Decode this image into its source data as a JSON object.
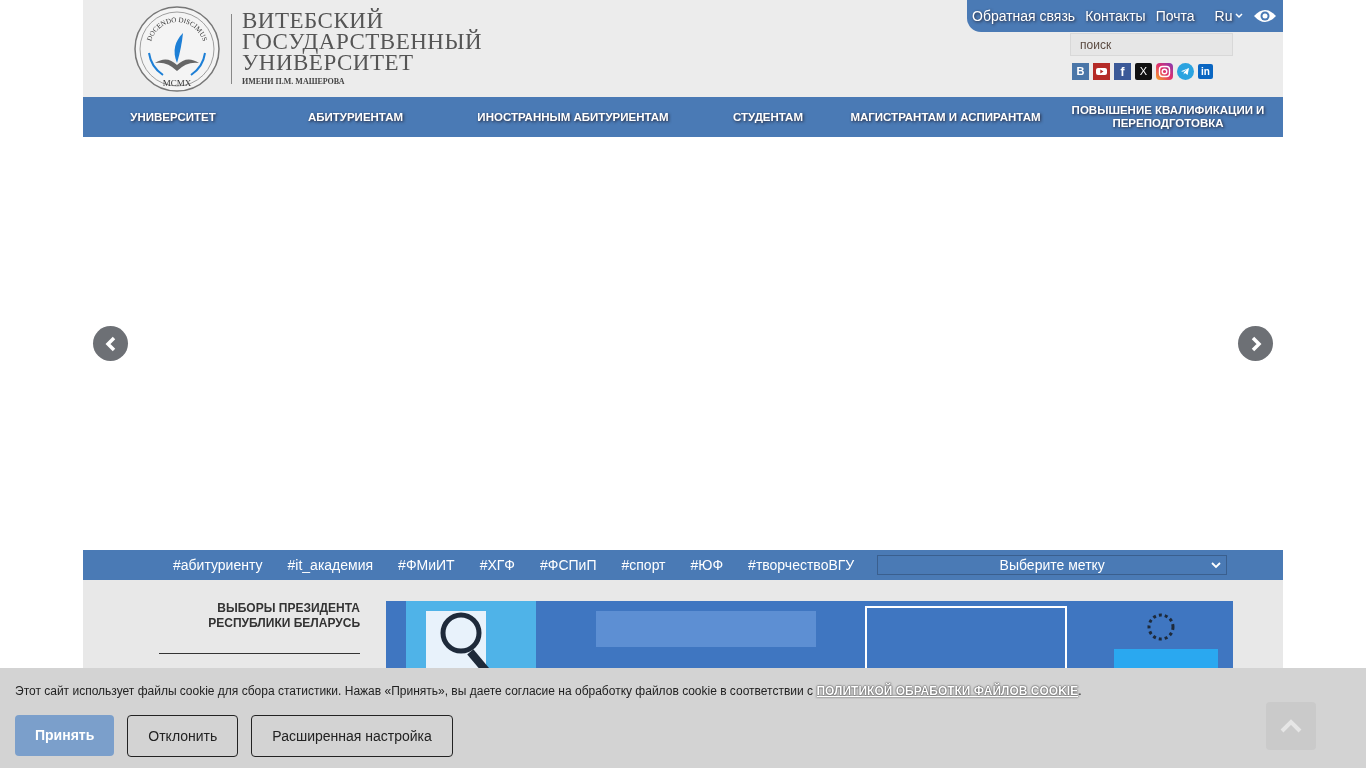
{
  "logo": {
    "motto": "DOCENDO DISCIMUS",
    "year": "MCMX",
    "lines": [
      "ВИТЕБСКИЙ",
      "ГОСУДАРСТВЕННЫЙ",
      "УНИВЕРСИТЕТ"
    ],
    "subtitle": "ИМЕНИ П.М. МАШЕРОВА"
  },
  "top_links": [
    "Обратная связь",
    "Контакты",
    "Почта"
  ],
  "language": "Ru",
  "search": {
    "placeholder": "поиск"
  },
  "social": [
    {
      "kind": "vk",
      "label": "B"
    },
    {
      "kind": "youtube"
    },
    {
      "kind": "facebook",
      "label": "f"
    },
    {
      "kind": "x",
      "label": "X"
    },
    {
      "kind": "instagram"
    },
    {
      "kind": "telegram"
    },
    {
      "kind": "linkedin",
      "label": "in"
    }
  ],
  "nav": [
    "УНИВЕРСИТЕТ",
    "АБИТУРИЕНТАМ",
    "ИНОСТРАННЫМ АБИТУРИЕНТАМ",
    "СТУДЕНТАМ",
    "МАГИСТРАНТАМ И АСПИРАНТАМ",
    "ПОВЫШЕНИЕ КВАЛИФИКАЦИИ И ПЕРЕПОДГОТОВКА"
  ],
  "tags": [
    "#абитуриенту",
    "#it_академия",
    "#ФМиИТ",
    "#ХГФ",
    "#ФСПиП",
    "#спорт",
    "#ЮФ",
    "#творчествоВГУ"
  ],
  "tag_select": "Выберите метку",
  "sidebar_heading": "ВЫБОРЫ ПРЕЗИДЕНТА РЕСПУБЛИКИ БЕЛАРУСЬ",
  "banner": {
    "kind": "picture"
  },
  "cookie": {
    "text": "Этот сайт использует файлы cookie для сбора статистики. Нажав «Принять», вы даете согласие на обработку файлов cookie в соответствии с ",
    "link": "ПОЛИТИКОЙ ОБРАБОТКИ ФАЙЛОВ COOKIE",
    "end": ".",
    "buttons": [
      {
        "label": "Принять",
        "kind": "primary"
      },
      {
        "label": "Отклонить",
        "kind": "outline"
      },
      {
        "label": "Расширенная настройка",
        "kind": "outline"
      }
    ]
  }
}
